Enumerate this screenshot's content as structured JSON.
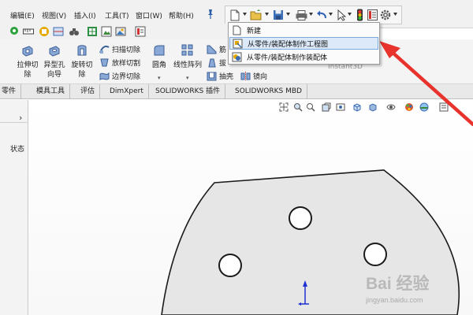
{
  "menubar": {
    "items": [
      "编辑(E)",
      "视图(V)",
      "插入(I)",
      "工具(T)",
      "窗口(W)",
      "帮助(H)"
    ]
  },
  "quick_bar": {
    "icons": [
      "new-file-icon",
      "open-file-icon",
      "save-icon",
      "print-icon",
      "undo-icon",
      "select-icon",
      "rebuild-icon",
      "file-properties-icon",
      "options-icon"
    ]
  },
  "dropdown": {
    "items": [
      {
        "label": "新建",
        "icon": "new-doc-icon"
      },
      {
        "label": "从零件/装配体制作工程图",
        "icon": "make-drawing-icon",
        "highlighted": true
      },
      {
        "label": "从零件/装配体制作装配体",
        "icon": "make-assembly-icon"
      }
    ]
  },
  "command_manager": {
    "extrude_cut": "拉伸切\n除",
    "hole_wizard": "异型孔\n向导",
    "revolve_cut": "旋转切\n除",
    "swept_cut": "扫描切除",
    "lofted_cut": "放样切割",
    "boundary_cut": "边界切除",
    "fillet": "圆角",
    "linear_pattern": "线性阵列",
    "rib": "筋",
    "draft": "拔",
    "shell": "抽壳",
    "mirror": "镜向",
    "instant3d": "Instant3D"
  },
  "tabs": [
    "零件",
    "模具工具",
    "评估",
    "DimXpert",
    "SOLIDWORKS 插件",
    "SOLIDWORKS MBD"
  ],
  "left_panel": {
    "chevron": "›",
    "status": "状态"
  },
  "watermark": {
    "main": "Bai 经验",
    "sub": "jingyan.baidu.com"
  },
  "colors": {
    "part_fill": "#e6e6e6",
    "part_outline": "#1a1a1a",
    "arrow": "#e8322c",
    "menu_highlight": "#dbe9f9",
    "axis_blue": "#2030d0"
  }
}
